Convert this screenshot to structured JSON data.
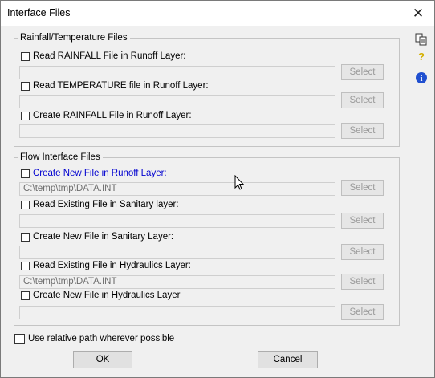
{
  "window": {
    "title": "Interface Files",
    "close_glyph": "✕"
  },
  "sidebar": {
    "icons": [
      {
        "name": "copy-pages-icon"
      },
      {
        "name": "help-question-icon",
        "glyph": "?"
      },
      {
        "name": "info-icon",
        "glyph": "i"
      }
    ]
  },
  "rainfall_group": {
    "legend": "Rainfall/Temperature Files",
    "rows": [
      {
        "label": "Read RAINFALL File in Runoff Layer:",
        "value": "",
        "button": "Select"
      },
      {
        "label": "Read TEMPERATURE file in Runoff Layer:",
        "value": "",
        "button": "Select"
      },
      {
        "label": "Create RAINFALL File in Runoff Layer:",
        "value": "",
        "button": "Select"
      }
    ]
  },
  "flow_group": {
    "legend": "Flow Interface Files",
    "rows": [
      {
        "label": "Create New File in Runoff Layer:",
        "value": "C:\\temp\\tmp\\DATA.INT",
        "button": "Select"
      },
      {
        "label": "Read Existing File in Sanitary layer:",
        "value": "",
        "button": "Select"
      },
      {
        "label": "Create New File in Sanitary Layer:",
        "value": "",
        "button": "Select"
      },
      {
        "label": "Read Existing File in Hydraulics Layer:",
        "value": "C:\\temp\\tmp\\DATA.INT",
        "button": "Select"
      },
      {
        "label": "Create New File in Hydraulics Layer",
        "value": "",
        "button": "Select"
      }
    ]
  },
  "relative_path": {
    "label": "Use relative path wherever possible"
  },
  "buttons": {
    "ok": "OK",
    "cancel": "Cancel"
  }
}
